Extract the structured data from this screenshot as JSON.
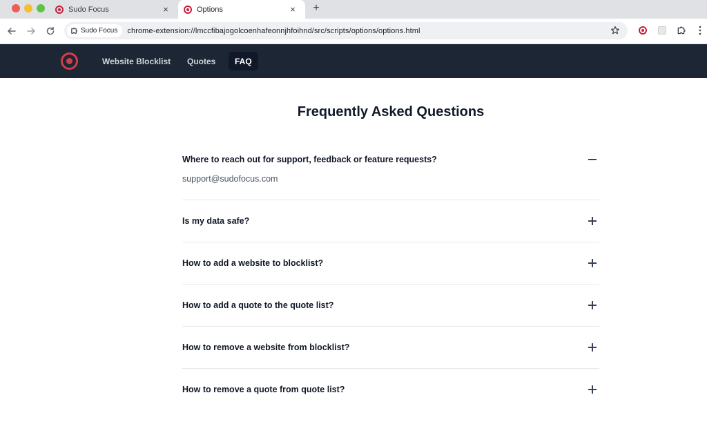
{
  "browser": {
    "tabs": [
      {
        "title": "Sudo Focus",
        "active": false
      },
      {
        "title": "Options",
        "active": true
      }
    ],
    "close_glyph": "×",
    "new_tab_glyph": "+",
    "omnibox": {
      "chip_label": "Sudo Focus",
      "url": "chrome-extension://lmccfibajogolcoenhafeonnjhfoihnd/src/scripts/options/options.html"
    },
    "icons": [
      "back-icon",
      "forward-icon",
      "reload-icon",
      "star-icon",
      "extension-icon",
      "puzzle-icon",
      "menu-icon"
    ]
  },
  "nav": {
    "brand_color": "#d43c48",
    "links": [
      {
        "label": "Website Blocklist",
        "active": false
      },
      {
        "label": "Quotes",
        "active": false
      },
      {
        "label": "FAQ",
        "active": true
      }
    ]
  },
  "faq": {
    "title": "Frequently Asked Questions",
    "items": [
      {
        "question": "Where to reach out for support, feedback or feature requests?",
        "answer": "support@sudofocus.com",
        "expanded": true
      },
      {
        "question": "Is my data safe?",
        "expanded": false
      },
      {
        "question": "How to add a website to blocklist?",
        "expanded": false
      },
      {
        "question": "How to add a quote to the quote list?",
        "expanded": false
      },
      {
        "question": "How to remove a website from blocklist?",
        "expanded": false
      },
      {
        "question": "How to remove a quote from quote list?",
        "expanded": false
      }
    ]
  }
}
